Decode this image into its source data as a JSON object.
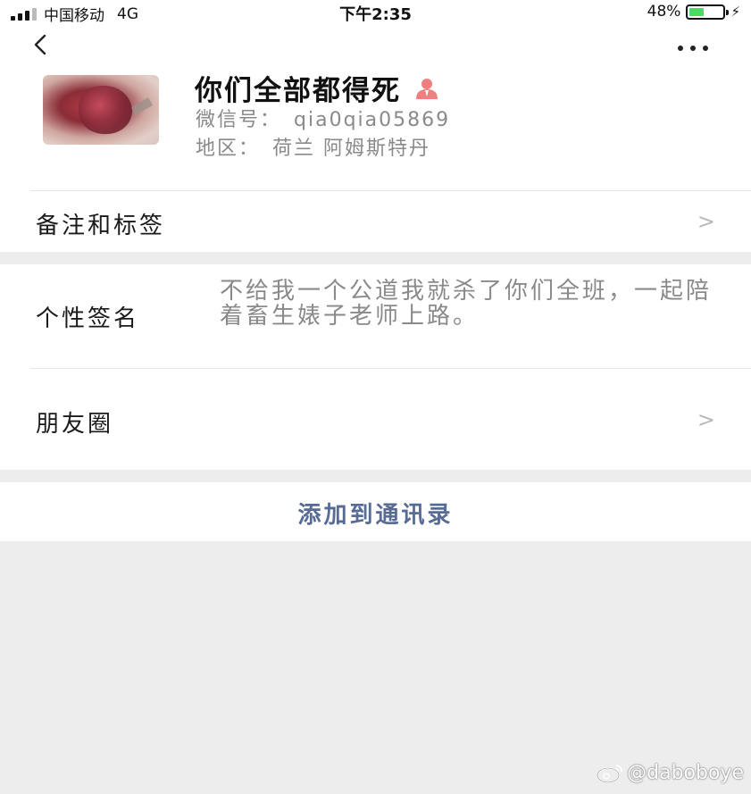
{
  "status_bar": {
    "carrier": "中国移动",
    "network": "4G",
    "time": "下午2:35",
    "battery_percent": "48%",
    "battery_level": 0.48
  },
  "nav": {
    "back_icon": "chevron-left-icon",
    "more_icon": "ellipsis-icon"
  },
  "profile": {
    "name": "你们全部都得死",
    "gender_icon": "male-user-icon",
    "wechat_label": "微信号：",
    "wechat_id": "qia0qia05869",
    "region_label": "地区：",
    "region": "荷兰 阿姆斯特丹"
  },
  "rows": {
    "tags_label": "备注和标签",
    "signature_label": "个性签名",
    "signature_text": "不给我一个公道我就杀了你们全班，一起陪着畜生婊子老师上路。",
    "moments_label": "朋友圈",
    "chevron": ">"
  },
  "actions": {
    "add_contact": "添加到通讯录"
  },
  "watermark": {
    "text": "@daboboye",
    "icon": "weibo-icon"
  },
  "colors": {
    "link_blue": "#576b95",
    "gray_text": "#8a8a8a",
    "battery_green": "#4cd964",
    "gender_icon": "#f08080",
    "page_bg": "#ededed"
  }
}
